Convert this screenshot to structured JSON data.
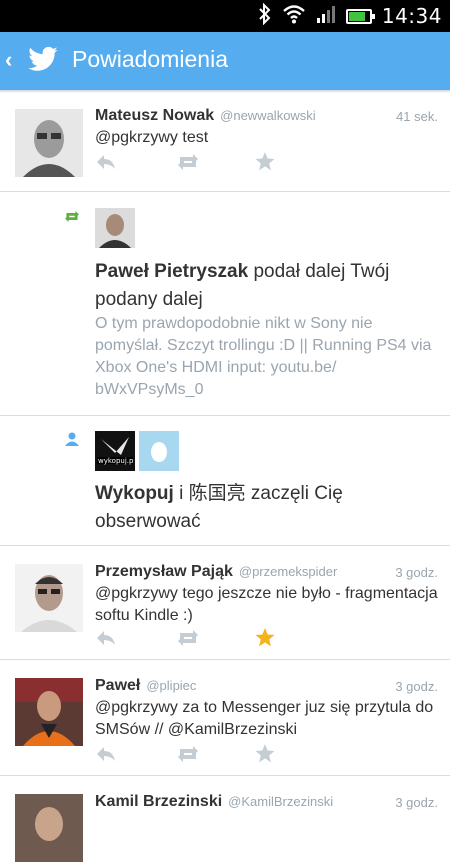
{
  "status_bar": {
    "time": "14:34",
    "battery_level": 0.75,
    "colors": {
      "battery": "#3ec43e"
    }
  },
  "header": {
    "title": "Powiadomienia",
    "back_glyph": "‹",
    "accent": "#55acee",
    "logo_icon": "twitter-bird-icon"
  },
  "notifications": [
    {
      "kind": "tweet",
      "name": "Mateusz Nowak",
      "handle": "@newwalkowski",
      "time": "41 sek.",
      "text": "@pgkrzywy test",
      "favorited": false
    },
    {
      "kind": "retweet",
      "name": "Paweł Pietryszak",
      "action": "podał dalej Twój podany dalej",
      "quoted": "O tym prawdopodobnie nikt w Sony nie pomyślał. Szczyt trollingu :D || Running PS4 via Xbox One's HDMI input: youtu.be/ bWxVPsyMs_0"
    },
    {
      "kind": "follow",
      "name1": "Wykopuj",
      "conj": "i",
      "name2": "陈国亮",
      "action": "zaczęli Cię obserwować",
      "avatar_logo": "wykopuj.p"
    },
    {
      "kind": "tweet",
      "name": "Przemysław Pająk",
      "handle": "@przemekspider",
      "time": "3 godz.",
      "text": "@pgkrzywy tego jeszcze nie było - fragmentacja softu Kindle :)",
      "favorited": true
    },
    {
      "kind": "tweet",
      "name": "Paweł",
      "handle": "@plipiec",
      "time": "3 godz.",
      "text": "@pgkrzywy za to Messenger juz się przytula do SMSów // @KamilBrzezinski",
      "favorited": false
    },
    {
      "kind": "tweet",
      "name": "Kamil Brzezinski",
      "handle": "@KamilBrzezinski",
      "time": "3 godz."
    }
  ],
  "colors": {
    "retweet_green": "#5fae3f",
    "follow_blue": "#55acee",
    "star_active": "#f5b31b",
    "muted": "#c4cdd4"
  }
}
